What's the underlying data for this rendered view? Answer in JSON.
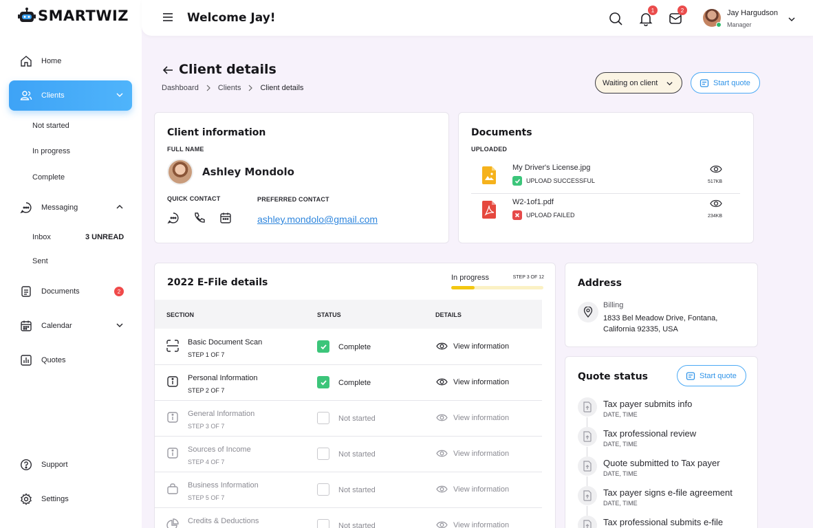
{
  "brand": {
    "name": "SMARTWIZ"
  },
  "header": {
    "welcome": "Welcome Jay!",
    "notifications_count": "1",
    "messages_count": "2",
    "user_name": "Jay Hargudson",
    "user_role": "Manager"
  },
  "sidebar": {
    "home": "Home",
    "clients": "Clients",
    "clients_sub": [
      "Not started",
      "In progress",
      "Complete"
    ],
    "messaging": "Messaging",
    "inbox": "Inbox",
    "inbox_unread": "3 UNREAD",
    "sent": "Sent",
    "documents": "Documents",
    "documents_badge": "2",
    "calendar": "Calendar",
    "quotes": "Quotes",
    "support": "Support",
    "settings": "Settings"
  },
  "page": {
    "title": "Client details",
    "breadcrumb": [
      "Dashboard",
      "Clients",
      "Client details"
    ],
    "status_select": "Waiting on client",
    "start_quote": "Start quote"
  },
  "client_info": {
    "title": "Client information",
    "full_name_label": "FULL NAME",
    "name": "Ashley Mondolo",
    "quick_contact_label": "QUICK CONTACT",
    "preferred_contact_label": "PREFERRED CONTACT",
    "email": "ashley.mondolo@gmail.com"
  },
  "documents": {
    "title": "Documents",
    "uploaded_label": "UPLOADED",
    "files": [
      {
        "name": "My Driver's License.jpg",
        "status": "UPLOAD SUCCESSFUL",
        "size": "517KB"
      },
      {
        "name": "W2-1of1.pdf",
        "status": "UPLOAD FAILED",
        "size": "234KB"
      }
    ]
  },
  "efile": {
    "title": "2022 E-File details",
    "progress_label": "In progress",
    "progress_step": "STEP 3 OF 12",
    "progress_fraction": 0.25,
    "columns": [
      "SECTION",
      "STATUS",
      "DETAILS"
    ],
    "view_label": "View information",
    "rows": [
      {
        "name": "Basic Document Scan",
        "step": "STEP 1 OF 7",
        "status": "Complete"
      },
      {
        "name": "Personal Information",
        "step": "STEP 2 OF 7",
        "status": "Complete"
      },
      {
        "name": "General Information",
        "step": "STEP 3 OF 7",
        "status": "Not started"
      },
      {
        "name": "Sources of Income",
        "step": "STEP 4 OF 7",
        "status": "Not started"
      },
      {
        "name": "Business Information",
        "step": "STEP 5 OF 7",
        "status": "Not started"
      },
      {
        "name": "Credits & Deductions",
        "step": "",
        "status": "Not started"
      }
    ]
  },
  "address": {
    "title": "Address",
    "type": "Billing",
    "line1": "1833 Bel Meadow Drive, Fontana,",
    "line2": "California 92335, USA"
  },
  "quote_status": {
    "title": "Quote status",
    "start_quote": "Start quote",
    "sub_label": "DATE, TIME",
    "items": [
      "Tax payer submits info",
      "Tax professional review",
      "Quote submitted to Tax payer",
      "Tax payer signs e-file agreement",
      "Tax professional submits e-file"
    ]
  }
}
